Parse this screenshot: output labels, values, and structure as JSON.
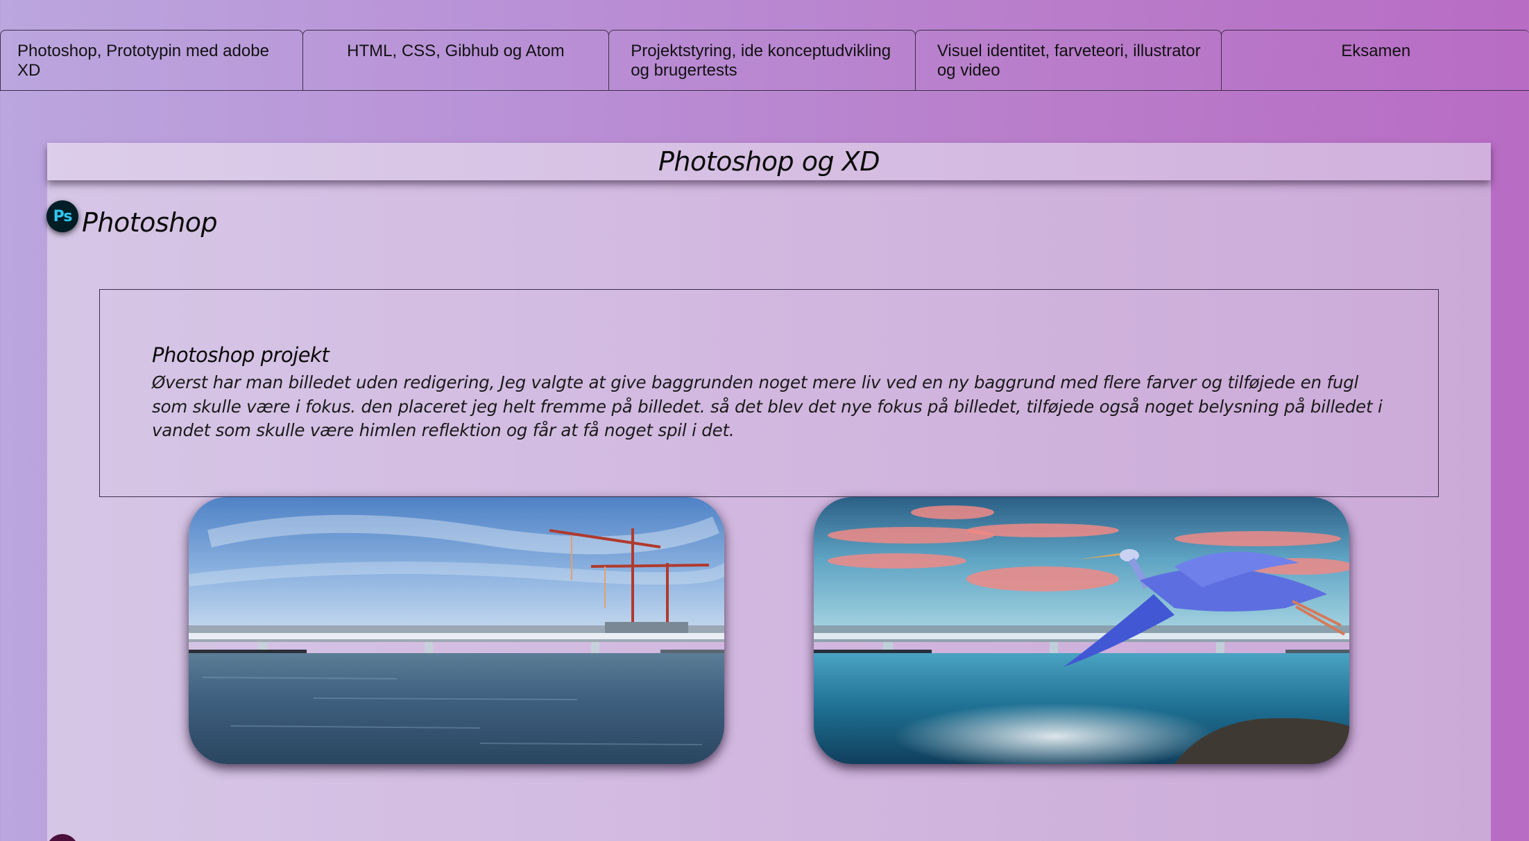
{
  "nav": {
    "tabs": [
      {
        "label": "Photoshop, Prototypin med adobe XD"
      },
      {
        "label": "HTML, CSS, Gibhub og Atom"
      },
      {
        "label": "Projektstyring, ide konceptudvikling og brugertests"
      },
      {
        "label": "Visuel identitet, farveteori, illustrator og video"
      },
      {
        "label": "Eksamen"
      }
    ]
  },
  "page": {
    "title": "Photoshop og XD"
  },
  "section": {
    "icon_label": "Ps",
    "icon": "photoshop-icon",
    "heading": "Photoshop"
  },
  "project": {
    "title": "Photoshop projekt",
    "text": "Øverst har man billedet uden redigering, Jeg valgte at give baggrunden noget mere liv ved en ny baggrund med flere farver og tilføjede en fugl som skulle være i fokus. den placeret jeg helt fremme på billedet. så det blev det nye fokus på billedet, tilføjede også noget belysning på billedet i vandet som skulle være himlen reflektion og får at få noget spil i det."
  },
  "colors": {
    "background_start": "#bba6de",
    "background_end": "#b86cc4",
    "panel": "#d2b9e0",
    "ps_icon_bg": "#001d26",
    "ps_icon_text": "#31c5f0"
  }
}
